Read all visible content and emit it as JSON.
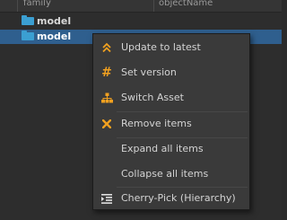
{
  "table": {
    "columns": [
      "family",
      "objectName"
    ],
    "rows": [
      {
        "label": "model",
        "selected": false
      },
      {
        "label": "model",
        "selected": true
      }
    ]
  },
  "context_menu": {
    "items": [
      {
        "label": "Update to latest",
        "icon": "double-chevron-up-icon"
      },
      {
        "label": "Set version",
        "icon": "hash-icon"
      },
      {
        "label": "Switch Asset",
        "icon": "hierarchy-icon"
      },
      {
        "label": "Remove items",
        "icon": "x-icon"
      },
      {
        "label": "Expand all items",
        "icon": ""
      },
      {
        "label": "Collapse all items",
        "icon": ""
      },
      {
        "label": "Cherry-Pick (Hierarchy)",
        "icon": "indent-list-icon"
      }
    ]
  },
  "colors": {
    "accent": "#f0a020",
    "selection": "#2f5f8e",
    "folder": "#3b9fd2",
    "menu_bg": "#3a3a3a"
  }
}
